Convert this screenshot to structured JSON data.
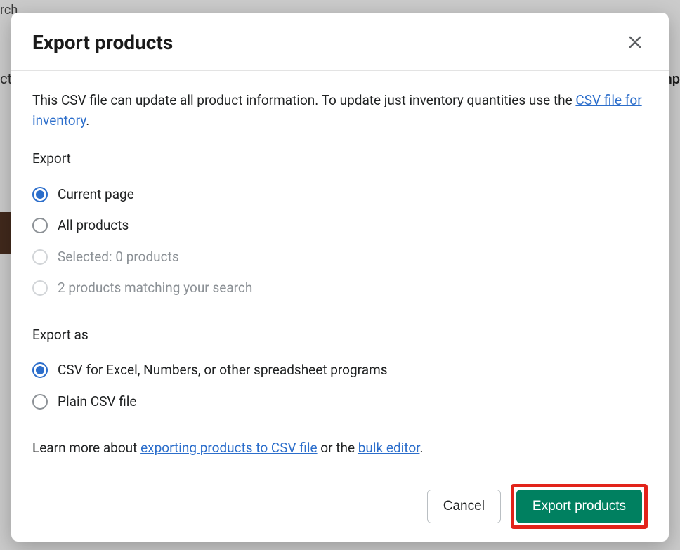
{
  "backdrop": {
    "search_placeholder": "rch",
    "left_fragment": "ct",
    "right_fragment": "mp"
  },
  "modal": {
    "title": "Export products",
    "intro_prefix": "This CSV file can update all product information. To update just inventory quantities use the ",
    "intro_link": "CSV file for inventory",
    "intro_suffix": ".",
    "export_section_label": "Export",
    "export_options": {
      "current_page": "Current page",
      "all_products": "All products",
      "selected": "Selected: 0 products",
      "matching": "2 products matching your search"
    },
    "export_as_label": "Export as",
    "export_as_options": {
      "csv_excel": "CSV for Excel, Numbers, or other spreadsheet programs",
      "plain_csv": "Plain CSV file"
    },
    "learn_prefix": "Learn more about ",
    "learn_link1": "exporting products to CSV file",
    "learn_mid": " or the ",
    "learn_link2": "bulk editor",
    "learn_suffix": ".",
    "cancel_label": "Cancel",
    "submit_label": "Export products"
  }
}
